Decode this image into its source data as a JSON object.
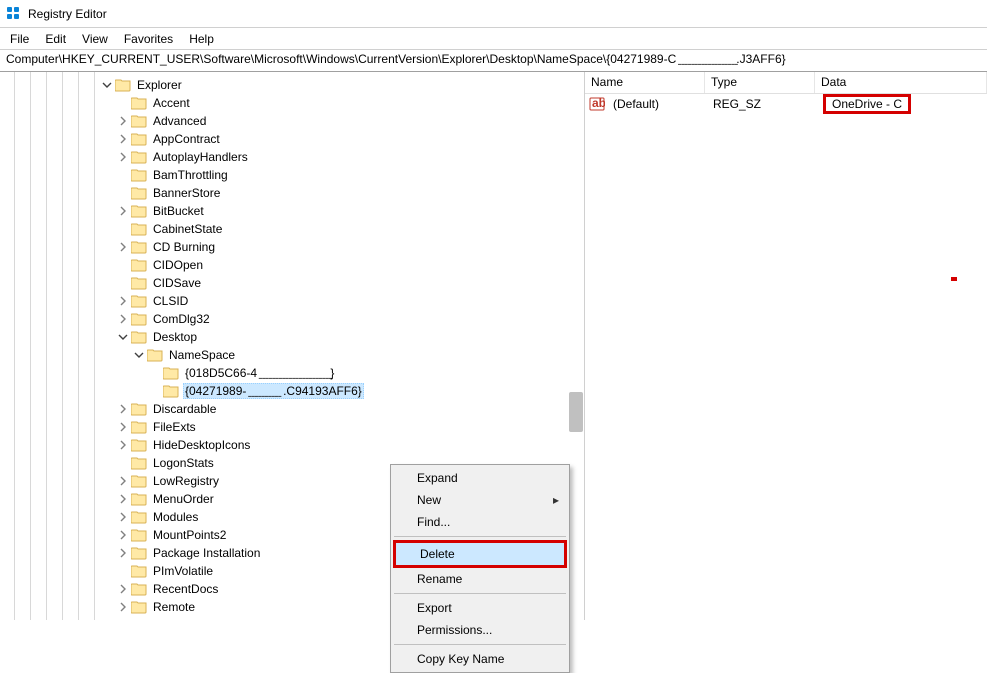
{
  "titlebar": {
    "title": "Registry Editor"
  },
  "menubar": {
    "file": "File",
    "edit": "Edit",
    "view": "View",
    "favorites": "Favorites",
    "help": "Help"
  },
  "addressbar": {
    "path": "Computer\\HKEY_CURRENT_USER\\Software\\Microsoft\\Windows\\CurrentVersion\\Explorer\\Desktop\\NameSpace\\{04271989-C  ̱ ̱   ̱ ̱ ̱ ̱   ̱ ̱ ̱ ̱   ̱ ̱ ̱ ̱ ̱ ̱ ̱ ̱.J3AFF6}"
  },
  "tree": {
    "explorer": "Explorer",
    "items": [
      "Accent",
      "Advanced",
      "AppContract",
      "AutoplayHandlers",
      "BamThrottling",
      "BannerStore",
      "BitBucket",
      "CabinetState",
      "CD Burning",
      "CIDOpen",
      "CIDSave",
      "CLSID",
      "ComDlg32",
      "Desktop"
    ],
    "namespace": "NameSpace",
    "ns_children": [
      "{018D5C66-4 ̱ ̱ ̱   ̱ ̱ ̱ ̱   ̱ ̱ ̱ ̱   ̱ ̱ ̱ ̱ ̱ ̱ ̱ ̱ ̱ ̱ ̱}",
      "{04271989- ̱ ̱ ̱   ̱ ̱ ̱   ̱ ̱ ̱ ̱  .C94193AFF6}"
    ],
    "after": [
      "Discardable",
      "FileExts",
      "HideDesktopIcons",
      "LogonStats",
      "LowRegistry",
      "MenuOrder",
      "Modules",
      "MountPoints2",
      "Package Installation",
      "PImVolatile",
      "RecentDocs",
      "Remote"
    ],
    "expandable": {
      "Accent": false,
      "Advanced": true,
      "AppContract": true,
      "AutoplayHandlers": true,
      "BamThrottling": false,
      "BannerStore": false,
      "BitBucket": true,
      "CabinetState": false,
      "CD Burning": true,
      "CIDOpen": false,
      "CIDSave": false,
      "CLSID": true,
      "ComDlg32": true,
      "Desktop": true,
      "Discardable": true,
      "FileExts": true,
      "HideDesktopIcons": true,
      "LogonStats": false,
      "LowRegistry": true,
      "MenuOrder": true,
      "Modules": true,
      "MountPoints2": true,
      "Package Installation": true,
      "PImVolatile": false,
      "RecentDocs": true,
      "Remote": true
    }
  },
  "list": {
    "headers": {
      "name": "Name",
      "type": "Type",
      "data": "Data"
    },
    "rows": [
      {
        "name": "(Default)",
        "type": "REG_SZ",
        "data": "OneDrive - C"
      }
    ]
  },
  "context_menu": {
    "expand": "Expand",
    "new": "New",
    "find": "Find...",
    "delete": "Delete",
    "rename": "Rename",
    "export": "Export",
    "permissions": "Permissions...",
    "copy_key": "Copy Key Name"
  }
}
